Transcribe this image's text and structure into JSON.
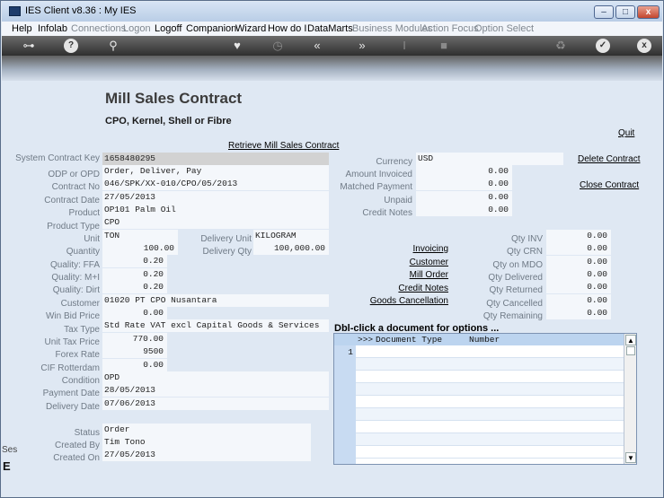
{
  "window": {
    "title": "IES Client v8.36 : My IES",
    "min": "–",
    "max": "□",
    "close": "x"
  },
  "menu": [
    {
      "label": "Help",
      "dim": false
    },
    {
      "label": "Infolab",
      "dim": false
    },
    {
      "label": "Connections",
      "dim": true
    },
    {
      "label": "Logon",
      "dim": true
    },
    {
      "label": "Logoff",
      "dim": false
    },
    {
      "label": "Companion",
      "dim": false
    },
    {
      "label": "Wizard",
      "dim": false
    },
    {
      "label": "How do I",
      "dim": false
    },
    {
      "label": "DataMarts",
      "dim": false
    },
    {
      "label": "Business Modules",
      "dim": true
    },
    {
      "label": "Action Focus",
      "dim": true
    },
    {
      "label": "Option Select",
      "dim": true
    }
  ],
  "toolbar": {
    "key": "⊶",
    "help": "?",
    "search": "⚲",
    "heart": "♥",
    "clock": "◷",
    "back": "«",
    "forward": "»",
    "text_cursor": "I",
    "stop": "■",
    "recycle": "♻",
    "check": "✓",
    "close": "x"
  },
  "page": {
    "title": "Mill Sales Contract",
    "subtitle": "CPO, Kernel, Shell or Fibre",
    "quit": "Quit",
    "retrieve": "Retrieve Mill Sales Contract",
    "delete": "Delete Contract",
    "close_contract": "Close Contract"
  },
  "left_fields": {
    "system_contract_key": {
      "label": "System Contract Key",
      "value": "1658480295"
    },
    "odp_or_opd": {
      "label": "ODP or OPD",
      "value": "Order, Deliver, Pay"
    },
    "contract_no": {
      "label": "Contract No",
      "value": "046/SPK/XX-010/CPO/05/2013"
    },
    "contract_date": {
      "label": "Contract Date",
      "value": "27/05/2013"
    },
    "product": {
      "label": "Product",
      "value": "OP101 Palm Oil"
    },
    "product_type": {
      "label": "Product Type",
      "value": "CPO"
    },
    "unit": {
      "label": "Unit",
      "value": "TON"
    },
    "delivery_unit": {
      "label": "Delivery Unit",
      "value": "KILOGRAM"
    },
    "quantity": {
      "label": "Quantity",
      "value": "100.00"
    },
    "delivery_qty": {
      "label": "Delivery Qty",
      "value": "100,000.00"
    },
    "quality_ffa": {
      "label": "Quality: FFA",
      "value": "0.20"
    },
    "quality_mi": {
      "label": "Quality: M+I",
      "value": "0.20"
    },
    "quality_dirt": {
      "label": "Quality: Dirt",
      "value": "0.20"
    },
    "customer": {
      "label": "Customer",
      "value": "01020 PT CPO Nusantara"
    },
    "win_bid_price": {
      "label": "Win Bid Price",
      "value": "0.00"
    },
    "tax_type": {
      "label": "Tax Type",
      "value": "Std Rate VAT excl Capital Goods & Services"
    },
    "unit_tax_price": {
      "label": "Unit Tax Price",
      "value": "770.00"
    },
    "forex_rate": {
      "label": "Forex Rate",
      "value": "9500"
    },
    "cif_rotterdam": {
      "label": "CIF Rotterdam",
      "value": "0.00"
    },
    "condition": {
      "label": "Condition",
      "value": "OPD"
    },
    "payment_date": {
      "label": "Payment Date",
      "value": "28/05/2013"
    },
    "delivery_date": {
      "label": "Delivery Date",
      "value": "07/06/2013"
    },
    "status": {
      "label": "Status",
      "value": "Order"
    },
    "created_by": {
      "label": "Created By",
      "value": "Tim Tono"
    },
    "created_on": {
      "label": "Created On",
      "value": "27/05/2013"
    }
  },
  "right_fields": {
    "currency": {
      "label": "Currency",
      "value": "USD"
    },
    "amount_invoiced": {
      "label": "Amount Invoiced",
      "value": "0.00"
    },
    "matched_payment": {
      "label": "Matched Payment",
      "value": "0.00"
    },
    "unpaid": {
      "label": "Unpaid",
      "value": "0.00"
    },
    "credit_notes": {
      "label": "Credit Notes",
      "value": "0.00"
    }
  },
  "doc_links": {
    "invoicing": "Invoicing",
    "customer": "Customer",
    "mill_order": "Mill Order",
    "credit_notes": "Credit Notes",
    "goods_cancellation": "Goods Cancellation"
  },
  "qty_fields": {
    "qty_inv": {
      "label": "Qty INV",
      "value": "0.00"
    },
    "qty_crn": {
      "label": "Qty CRN",
      "value": "0.00"
    },
    "qty_on_mdo": {
      "label": "Qty on MDO",
      "value": "0.00"
    },
    "qty_delivered": {
      "label": "Qty Delivered",
      "value": "0.00"
    },
    "qty_returned": {
      "label": "Qty Returned",
      "value": "0.00"
    },
    "qty_cancelled": {
      "label": "Qty Cancelled",
      "value": "0.00"
    },
    "qty_remaining": {
      "label": "Qty Remaining",
      "value": "0.00"
    }
  },
  "documents": {
    "header": "Dbl-click a document for options ...",
    "col_marker": ">>>",
    "col_type": "Document Type",
    "col_number": "Number",
    "row_number": "1",
    "scroll_up": "▲",
    "scroll_down": "▼"
  },
  "background": {
    "fragment1": "Ses",
    "fragment2": "E"
  }
}
